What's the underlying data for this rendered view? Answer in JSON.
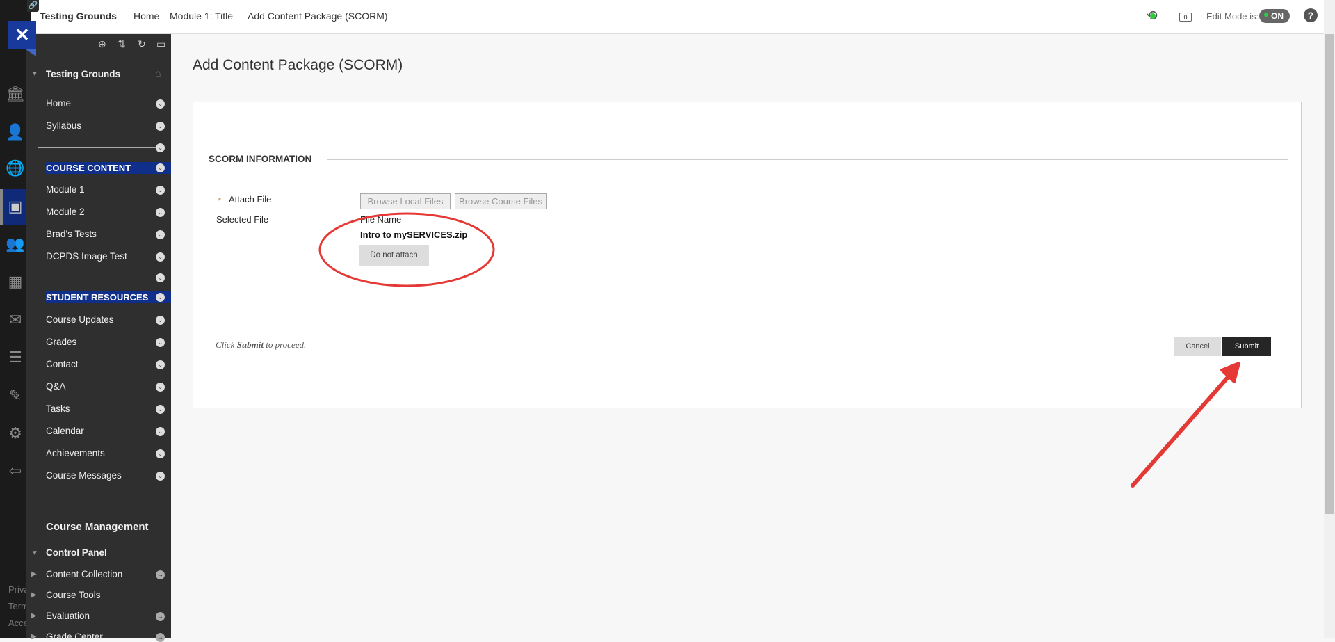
{
  "topbar": {
    "course": "Testing Grounds",
    "breadcrumbs": [
      "Home",
      "Module 1: Title",
      "Add Content Package (SCORM)"
    ],
    "edit_mode_label": "Edit Mode is:",
    "edit_mode_value": "ON",
    "lock_count": "0"
  },
  "rail": {
    "footer": [
      "Priva",
      "Term",
      "Acce"
    ]
  },
  "sidebar": {
    "course_title": "Testing Grounds",
    "top_items": [
      "Home",
      "Syllabus"
    ],
    "course_content": {
      "label": "COURSE CONTENT",
      "items": [
        "Module 1",
        "Module 2",
        "Brad's Tests",
        "DCPDS Image Test"
      ]
    },
    "student_resources": {
      "label": "STUDENT RESOURCES",
      "items": [
        "Course Updates",
        "Grades",
        "Contact",
        "Q&A",
        "Tasks",
        "Calendar",
        "Achievements",
        "Course Messages"
      ]
    },
    "course_management": "Course Management",
    "control_panel": {
      "label": "Control Panel",
      "items": [
        "Content Collection",
        "Course Tools",
        "Evaluation",
        "Grade Center"
      ]
    }
  },
  "page": {
    "title": "Add Content Package (SCORM)",
    "section": "SCORM INFORMATION",
    "attach_label": "Attach File",
    "required_mark": "*",
    "browse_local": "Browse Local Files",
    "browse_course": "Browse Course Files",
    "selected_label": "Selected File",
    "file_name_header": "File Name",
    "file_name": "Intro to mySERVICES.zip",
    "do_not_attach": "Do not attach",
    "instruction_pre": "Click ",
    "instruction_bold": "Submit",
    "instruction_post": " to proceed.",
    "cancel": "Cancel",
    "submit": "Submit"
  },
  "colors": {
    "accent": "#0f2f8a",
    "annotation": "#e53935",
    "submit_bg": "#262626"
  }
}
